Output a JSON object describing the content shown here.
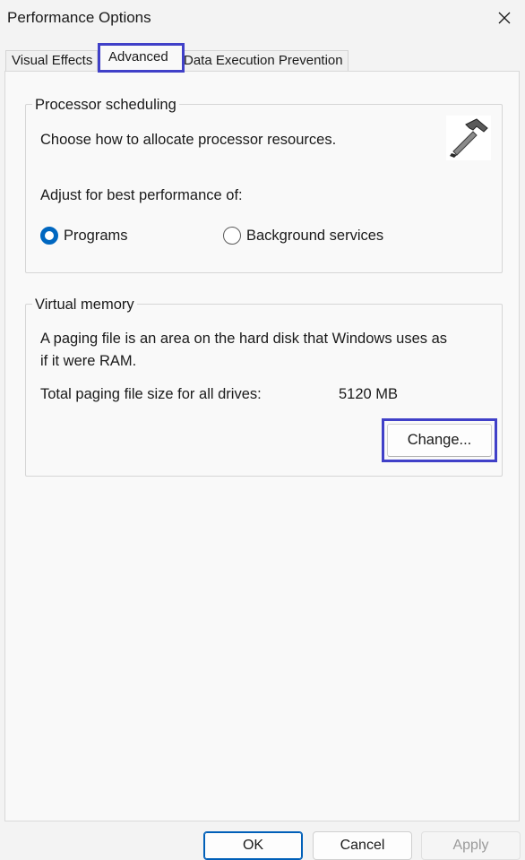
{
  "window": {
    "title": "Performance Options"
  },
  "tabs": [
    {
      "label": "Visual Effects"
    },
    {
      "label": "Advanced",
      "active": true
    },
    {
      "label": "Data Execution Prevention"
    }
  ],
  "processor": {
    "legend": "Processor scheduling",
    "description": "Choose how to allocate processor resources.",
    "adjust_label": "Adjust for best performance of:",
    "options": [
      {
        "label": "Programs",
        "checked": true
      },
      {
        "label": "Background services",
        "checked": false
      }
    ],
    "icon": "hammer-icon"
  },
  "virtual_memory": {
    "legend": "Virtual memory",
    "description_line1": "A paging file is an area on the hard disk that Windows uses as",
    "description_line2": "if it were RAM.",
    "total_label": "Total paging file size for all drives:",
    "total_value": "5120 MB",
    "change_label": "Change..."
  },
  "footer": {
    "ok_label": "OK",
    "cancel_label": "Cancel",
    "apply_label": "Apply"
  },
  "colors": {
    "accent": "#0067c0",
    "highlight": "#4040c8"
  }
}
